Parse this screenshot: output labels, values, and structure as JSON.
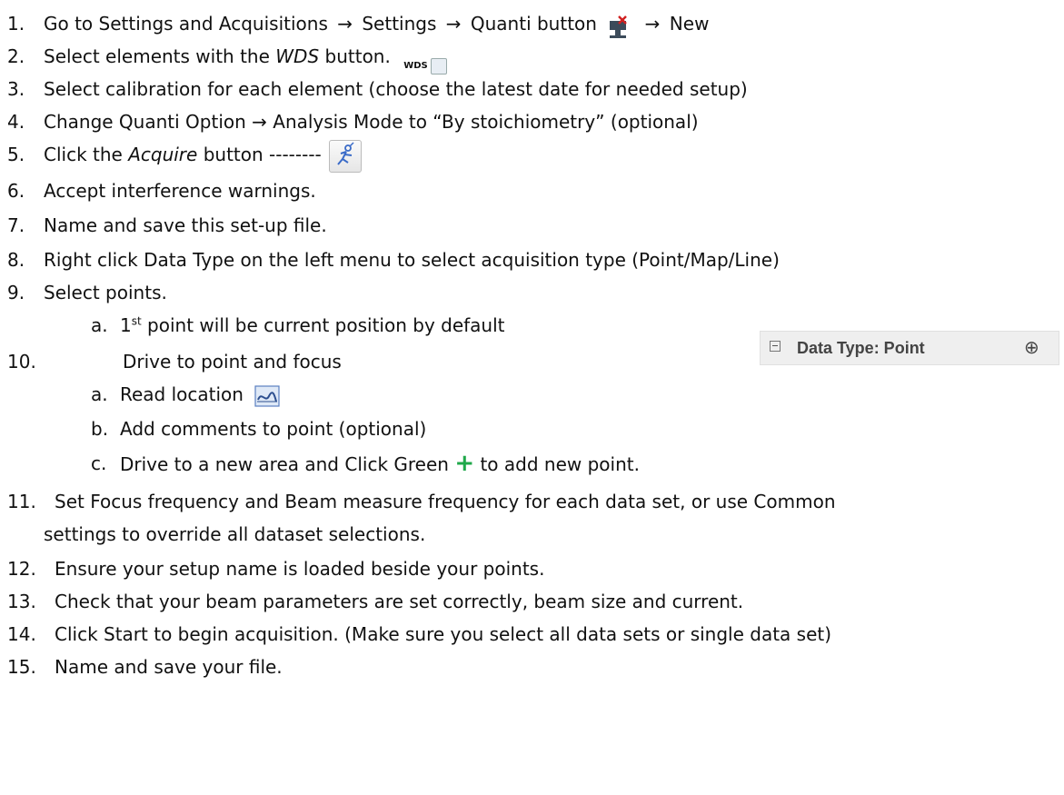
{
  "steps": [
    {
      "num": "1.",
      "a": "Go to Settings and Acquisitions",
      "b": "Settings",
      "c": "Quanti button",
      "d": "New"
    },
    {
      "num": "2.",
      "a": "Select elements with the ",
      "em": "WDS",
      "b": " button.",
      "icon_text": "WDS"
    },
    {
      "num": "3.",
      "text": "Select calibration for each element (choose the latest date for needed setup)"
    },
    {
      "num": "4.",
      "text": "Change Quanti Option → Analysis Mode to “By stoichiometry” (optional)"
    },
    {
      "num": "5.",
      "a": "Click the ",
      "em": "Acquire",
      "b": " button --------"
    },
    {
      "num": "6.",
      "text": "Accept interference warnings."
    },
    {
      "num": "7.",
      "text": "Name and save this set-up file."
    },
    {
      "num": "8.",
      "text": "Right click Data Type on the left menu to select acquisition type (Point/Map/Line)"
    },
    {
      "num": "9.",
      "text": "Select points."
    },
    {
      "num": "a.",
      "pre": "1",
      "sup": "st",
      "post": " point will be current position by default"
    },
    {
      "num": "10.",
      "text": "Drive to point and focus"
    },
    {
      "num": "a.",
      "text": "Read location"
    },
    {
      "num": "b.",
      "text": "Add comments to point (optional)"
    },
    {
      "num": "c.",
      "text": "Drive to a new area and Click Green",
      "plus": "+",
      "post": " to add new point."
    },
    {
      "num": "11.",
      "text": "Set Focus frequency and Beam measure frequency for each data set, or use Common",
      "text2": "settings to override all dataset selections."
    },
    {
      "num": "12.",
      "text": "Ensure your setup name is loaded beside your points."
    },
    {
      "num": "13.",
      "text": "Check that your beam parameters are set correctly, beam size and current."
    },
    {
      "num": "14.",
      "text": "Click Start to begin acquisition. (Make sure you select all data sets or single data set)"
    },
    {
      "num": "15.",
      "text": "Name and save your file."
    }
  ],
  "arrow": "→",
  "datatype_panel": {
    "label": "Data Type: Point",
    "plus_glyph": "⊕"
  },
  "icons": {
    "quanti": "quanti-button-icon",
    "wds": "wds-button-icon",
    "acquire": "acquire-runner-icon",
    "read": "read-location-icon"
  }
}
